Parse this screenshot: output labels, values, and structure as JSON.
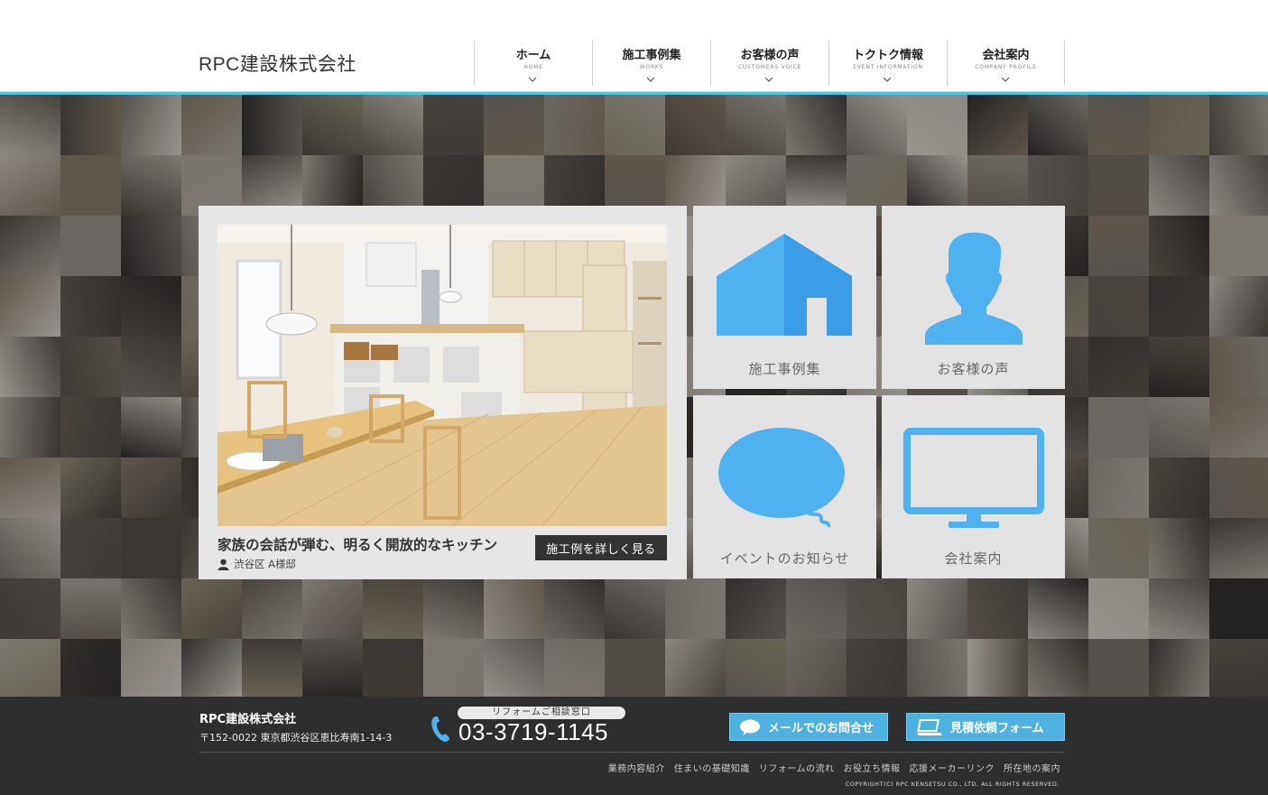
{
  "header": {
    "logo": "RPC建設株式会社",
    "nav": [
      {
        "jp": "ホーム",
        "en": "HOME"
      },
      {
        "jp": "施工事例集",
        "en": "WORKS"
      },
      {
        "jp": "お客様の声",
        "en": "CUSTOMERS VOICE"
      },
      {
        "jp": "トクトク情報",
        "en": "EVENT INFORMATION"
      },
      {
        "jp": "会社案内",
        "en": "COMPANY PROFILE"
      }
    ],
    "accent_color": "#4cc3e8"
  },
  "feature": {
    "title": "家族の会話が弾む、明るく開放的なキッチン",
    "customer": "渋谷区 A様邸",
    "button": "施工例を詳しく見る"
  },
  "tiles": {
    "works": {
      "label": "施工事例集",
      "icon": "house-icon"
    },
    "voice": {
      "label": "お客様の声",
      "icon": "person-icon"
    },
    "events": {
      "label": "イベントのお知らせ",
      "icon": "speech-bubble-icon"
    },
    "company": {
      "label": "会社案内",
      "icon": "monitor-icon"
    },
    "icon_color": "#4fb1f0"
  },
  "footer": {
    "company": "RPC建設株式会社",
    "address": "〒152-0022 東京都渋谷区恵比寿南1-14-3",
    "phone_label": "リフォームご相談窓口",
    "phone": "03-3719-1145",
    "mail_button": "メールでのお問合せ",
    "estimate_button": "見積依頼フォーム",
    "links": [
      "業務内容紹介",
      "住まいの基礎知識",
      "リフォームの流れ",
      "お役立ち情報",
      "応援メーカーリンク",
      "所在地の案内"
    ],
    "copyright": "COPYRIGHT(C) RPC KENSETSU CO., LTD. ALL RIGHTS RESERVED."
  }
}
